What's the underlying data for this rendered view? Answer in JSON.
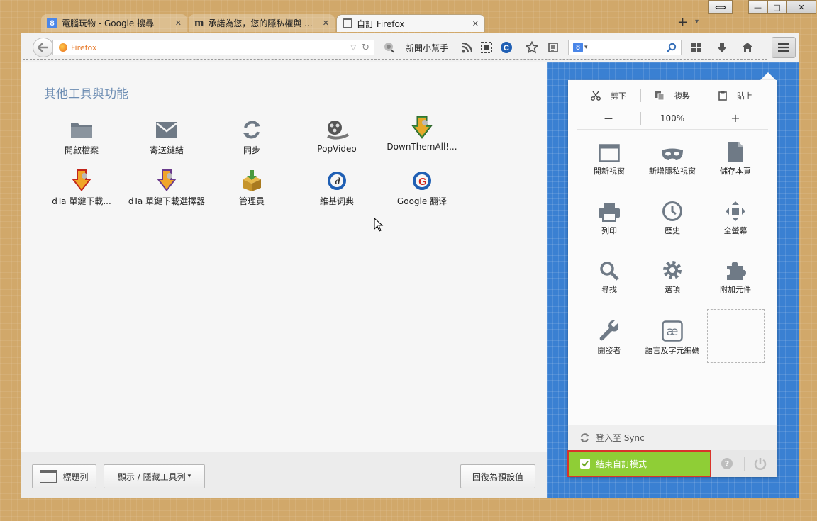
{
  "window": {
    "restore_glyph": "⟺",
    "minimize_glyph": "—",
    "maximize_glyph": "□",
    "close_glyph": "✕"
  },
  "tabs": [
    {
      "title": "電腦玩物 - Google 搜尋",
      "favicon": "google-favicon",
      "favicon_text": "8"
    },
    {
      "title": "承諾為您，您的隱私權與 ...",
      "favicon": "mozilla-m-favicon",
      "favicon_text": "m"
    },
    {
      "title": "自訂 Firefox",
      "favicon": "customize-favicon",
      "active": true
    }
  ],
  "tabbar": {
    "new_tab": "+",
    "list_tabs": "▾"
  },
  "toolbar": {
    "url_placeholder": "Firefox",
    "news_label": "新聞小幫手",
    "search_engine_letter": "8",
    "search_engine_arrow": "▾"
  },
  "content": {
    "heading": "其他工具與功能",
    "tools": [
      {
        "label": "開啟檔案",
        "icon": "folder-icon"
      },
      {
        "label": "寄送鏈結",
        "icon": "envelope-icon"
      },
      {
        "label": "同步",
        "icon": "sync-icon"
      },
      {
        "label": "PopVideo",
        "icon": "film-reel-icon"
      },
      {
        "label": "DownThemAll!...",
        "icon": "downthemall-icon"
      },
      {
        "label": "dTa 單鍵下載...",
        "icon": "dta-oneclick-icon"
      },
      {
        "label": "dTa 單鍵下載選擇器",
        "icon": "dta-selector-icon"
      },
      {
        "label": "管理員",
        "icon": "manager-box-icon"
      },
      {
        "label": "維基词典",
        "icon": "wiktionary-icon",
        "icon_text": "d"
      },
      {
        "label": "Google 翻译",
        "icon": "google-translate-icon",
        "icon_text": "G"
      }
    ]
  },
  "bottombar": {
    "titlebar_button": "標題列",
    "toolbars_button": "顯示 / 隱藏工具列",
    "toolbars_caret": "▾",
    "restore_defaults": "回復為預設值"
  },
  "menu": {
    "cut": "剪下",
    "copy": "複製",
    "paste": "貼上",
    "zoom_out": "—",
    "zoom_level": "100%",
    "zoom_in": "+",
    "items": [
      {
        "label": "開新視窗",
        "icon": "new-window-icon"
      },
      {
        "label": "新增隱私視窗",
        "icon": "private-mask-icon"
      },
      {
        "label": "儲存本頁",
        "icon": "save-page-icon"
      },
      {
        "label": "列印",
        "icon": "printer-icon"
      },
      {
        "label": "歷史",
        "icon": "history-clock-icon"
      },
      {
        "label": "全螢幕",
        "icon": "fullscreen-icon"
      },
      {
        "label": "尋找",
        "icon": "magnifier-icon"
      },
      {
        "label": "選項",
        "icon": "gear-icon"
      },
      {
        "label": "附加元件",
        "icon": "puzzle-icon"
      },
      {
        "label": "開發者",
        "icon": "wrench-icon"
      },
      {
        "label": "語言及字元編碼",
        "icon": "character-encoding-icon",
        "icon_text": "æ"
      }
    ],
    "sync_label": "登入至 Sync",
    "exit_customize": "結束自訂模式",
    "help_glyph": "?"
  },
  "colors": {
    "accent_green": "#8fce36",
    "exit_border": "#d9342b",
    "panel_blue": "#3a80d2",
    "desk": "#d1a86a"
  }
}
